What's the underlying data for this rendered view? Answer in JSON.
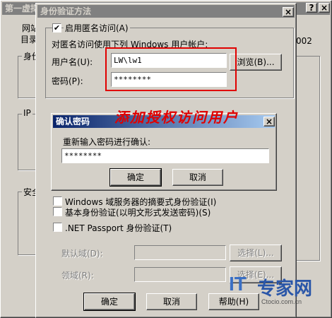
{
  "back_window": {
    "title": "第一虚拟",
    "tab_web": "网站",
    "tab_dir": "目录",
    "group_auth_label": "身份",
    "group_ip_label": "IP",
    "group_secure_label": "安全",
    "right_value": "002"
  },
  "auth_dialog": {
    "title": "身份验证方法",
    "anon_checkbox_label": "启用匿名访问(A)",
    "anon_checked": "✔",
    "anon_description": "对匿名访问使用下列 Windows 用户帐户:",
    "username_label": "用户名(U):",
    "username_value": "LW\\lw1",
    "browse_button": "浏览(B)...",
    "password_label": "密码(P):",
    "password_value": "********",
    "digest_label": "Windows 域服务器的摘要式身份验证(I)",
    "basic_label": "基本身份验证(以明文形式发送密码)(S)",
    "passport_label": ".NET Passport 身份验证(T)",
    "default_domain_label": "默认域(D):",
    "realm_label": "领域(R):",
    "select_button_1": "选择(L)...",
    "select_button_2": "选择(E)...",
    "ok_button": "确定",
    "cancel_button": "取消",
    "help_button": "帮助(H)"
  },
  "confirm_dialog": {
    "title": "确认密码",
    "prompt": "重新输入密码进行确认:",
    "password_value": "********",
    "ok_button": "确定",
    "cancel_button": "取消"
  },
  "annotation": {
    "text": "添加授权访问用户",
    "color": "#e00000"
  },
  "watermark": {
    "brand_it": "IT",
    "brand_cn": "专家网",
    "site": "Ctocio.com.cn"
  }
}
